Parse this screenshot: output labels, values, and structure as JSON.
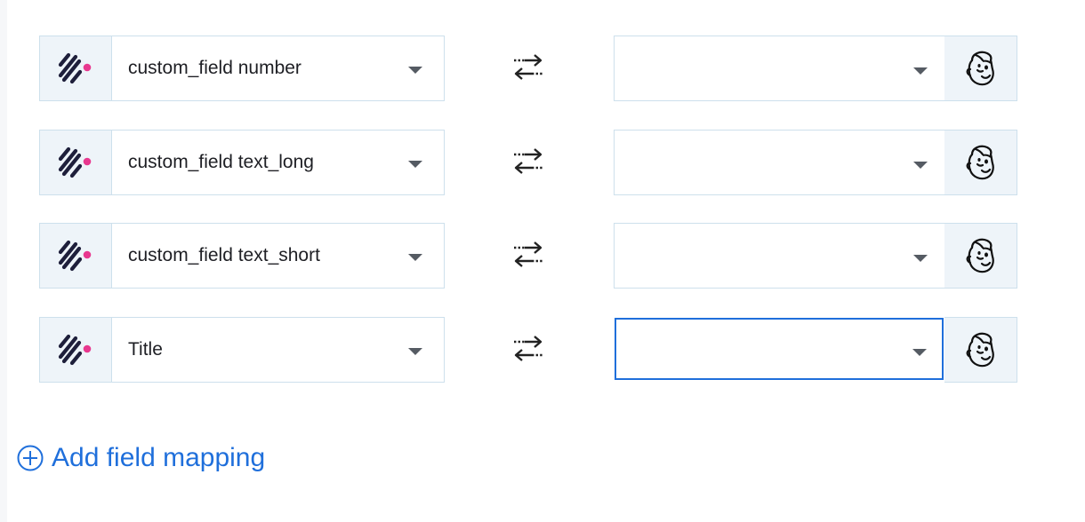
{
  "mappings": [
    {
      "source_field": "custom_field number",
      "target_field": "",
      "focused": false
    },
    {
      "source_field": "custom_field text_long",
      "target_field": "",
      "focused": false
    },
    {
      "source_field": "custom_field text_short",
      "target_field": "",
      "focused": false
    },
    {
      "source_field": "Title",
      "target_field": "",
      "focused": true
    }
  ],
  "icons": {
    "source_app": "brand-slashes-logo-icon",
    "swap": "swap-arrows-icon",
    "target_app": "mailchimp-logo-icon",
    "add": "plus-circle-icon"
  },
  "colors": {
    "accent": "#1f6fdb",
    "brand_dot": "#e8388f",
    "brand_slashes": "#1e1f3b",
    "icon_box_bg": "#eef4f9",
    "border": "#cde0ec"
  },
  "actions": {
    "add_mapping_label": "Add field mapping"
  }
}
